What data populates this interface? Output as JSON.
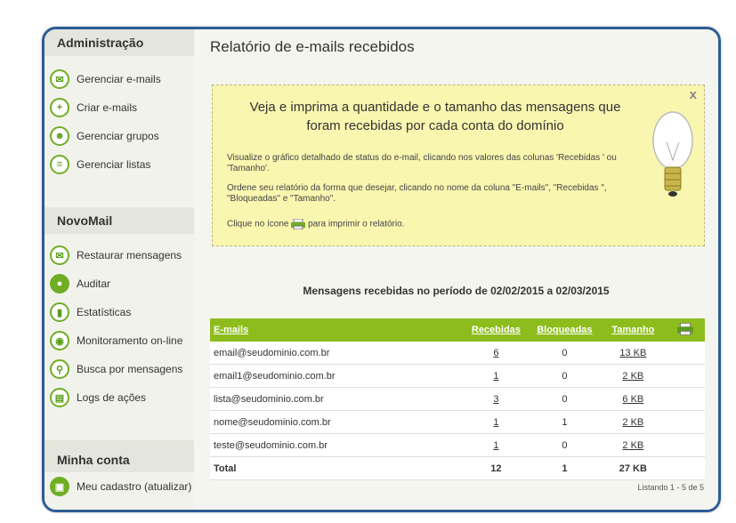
{
  "sidebar": {
    "admin": {
      "title": "Administração",
      "items": [
        {
          "label": "Gerenciar e-mails",
          "icon": "envelope-icon"
        },
        {
          "label": "Criar e-mails",
          "icon": "plus-icon"
        },
        {
          "label": "Gerenciar grupos",
          "icon": "group-icon"
        },
        {
          "label": "Gerenciar listas",
          "icon": "list-icon"
        }
      ]
    },
    "novomail": {
      "title": "NovoMail",
      "items": [
        {
          "label": "Restaurar mensagens",
          "icon": "restore-icon"
        },
        {
          "label": "Auditar",
          "icon": "user-icon"
        },
        {
          "label": "Estatísticas",
          "icon": "stats-icon"
        },
        {
          "label": "Monitoramento on-line",
          "icon": "monitor-icon"
        },
        {
          "label": "Busca por mensagens",
          "icon": "search-icon"
        },
        {
          "label": "Logs de ações",
          "icon": "log-icon"
        }
      ]
    },
    "account": {
      "title": "Minha conta",
      "items": [
        {
          "label": "Meu cadastro (atualizar)",
          "icon": "profile-icon"
        }
      ]
    }
  },
  "main": {
    "title": "Relatório de e-mails recebidos",
    "info": {
      "headline": "Veja e imprima a quantidade e o tamanho das mensagens que foram recebidas por cada conta do domínio",
      "p1": "Visualize o gráfico detalhado de status do e-mail, clicando nos valores das colunas 'Recebidas ' ou 'Tamanho'.",
      "p2": "Ordene seu relatório da forma que desejar, clicando no nome da coluna \"E-mails\", \"Recebidas \", \"Bloqueadas\" e \"Tamanho\".",
      "p3_pre": "Clique no ícone",
      "p3_post": "para imprimir o relatório.",
      "close": "x"
    },
    "period": "Mensagens recebidas no período de 02/02/2015 a 02/03/2015",
    "table": {
      "headers": {
        "email": "E-mails",
        "received": "Recebidas",
        "blocked": "Bloqueadas",
        "size": "Tamanho"
      },
      "rows": [
        {
          "email": "email@seudominio.com.br",
          "received": "6",
          "blocked": "0",
          "size": "13 KB"
        },
        {
          "email": "email1@seudominio.com.br",
          "received": "1",
          "blocked": "0",
          "size": "2 KB"
        },
        {
          "email": "lista@seudominio.com.br",
          "received": "3",
          "blocked": "0",
          "size": "6 KB"
        },
        {
          "email": "nome@seudominio.com.br",
          "received": "1",
          "blocked": "1",
          "size": "2 KB"
        },
        {
          "email": "teste@seudominio.com.br",
          "received": "1",
          "blocked": "0",
          "size": "2 KB"
        }
      ],
      "total": {
        "label": "Total",
        "received": "12",
        "blocked": "1",
        "size": "27 KB"
      }
    },
    "listing": "Listando 1 - 5 de 5"
  },
  "colors": {
    "frame": "#2c5d95",
    "accent": "#8dbd1c",
    "info_bg": "#f9f6b0"
  }
}
